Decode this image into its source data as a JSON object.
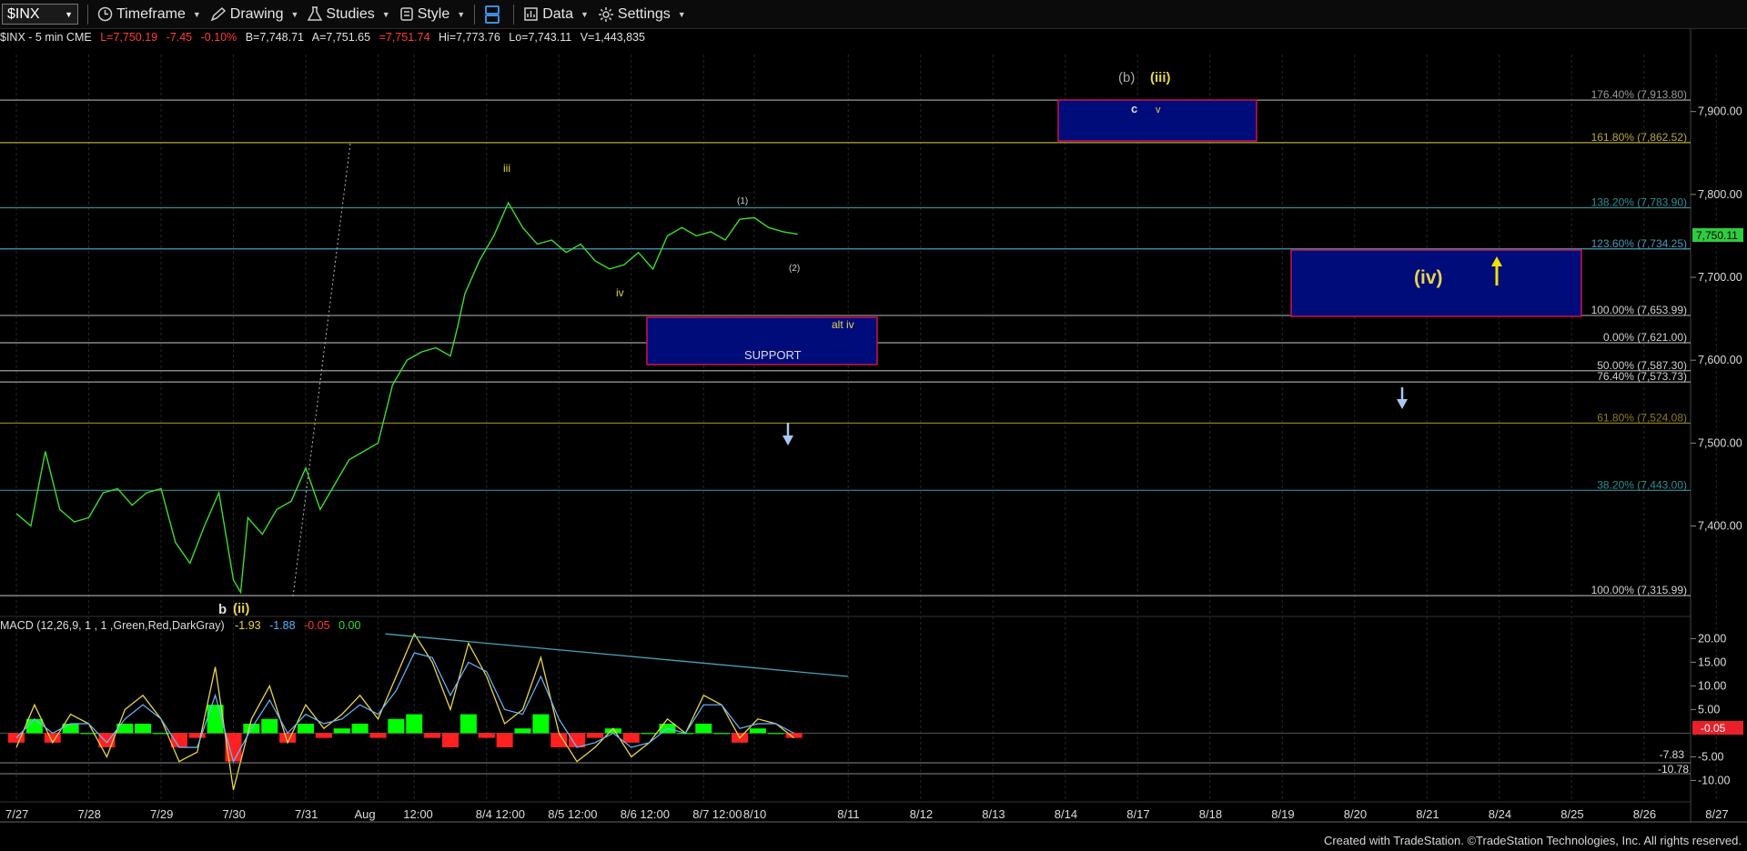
{
  "toolbar": {
    "symbol": "$INX",
    "timeframe": "Timeframe",
    "drawing": "Drawing",
    "studies": "Studies",
    "style": "Style",
    "data": "Data",
    "settings": "Settings"
  },
  "info": {
    "name": "$INX - 5 min  CME",
    "last": "L=7,750.19",
    "chg": "-7.45",
    "pct": "-0.10%",
    "bid": "B=7,748.71",
    "ask": "A=7,751.65",
    "boxed": "=7,751.74",
    "hi": "Hi=7,773.76",
    "lo": "Lo=7,743.11",
    "vol": "V=1,443,835"
  },
  "macd_info": {
    "label": "MACD (12,26,9, 1 , 1 ,Green,Red,DarkGray)",
    "v1": "-1.93",
    "v2": "-1.88",
    "v3": "-0.05",
    "v4": "0.00",
    "marker_lo1": "-7.83",
    "marker_lo2": "-10.78"
  },
  "colors": {
    "price": "#3ddc2e",
    "macd_up": "#00ff00",
    "macd_down": "#ff2020",
    "box_fill": "#000c7a",
    "box_border": "#d0104a",
    "up_text": "#ff3b3b",
    "down_text": "#ff3b3b",
    "wave_yellow": "#e8d44a"
  },
  "chart_data": {
    "type": "line",
    "price_axis": {
      "ticks": [
        "7,900.00",
        "7,800.00",
        "7,700.00",
        "7,600.00",
        "7,500.00",
        "7,400.00"
      ],
      "values": [
        7900,
        7800,
        7700,
        7600,
        7500,
        7400
      ],
      "range": [
        7315,
        7915
      ],
      "current": "7,750.11",
      "current_value": 7750.11
    },
    "macd_axis": {
      "ticks": [
        "20.00",
        "15.00",
        "10.00",
        "5.00",
        "-5.00",
        "-10.00"
      ],
      "values": [
        20,
        15,
        10,
        5,
        -5,
        -10
      ],
      "range": [
        -13,
        22
      ],
      "current": "-0.05",
      "current_value": -0.05
    },
    "dates": [
      "7/27",
      "7/28",
      "7/29",
      "7/30",
      "7/31",
      "Aug",
      "12:00",
      "8/4 12:00",
      "8/5 12:00",
      "8/6 12:00",
      "8/7 12:00",
      "8/10",
      "8/11",
      "8/12",
      "8/13",
      "8/14",
      "8/17",
      "8/18",
      "8/19",
      "8/20",
      "8/21",
      "8/24",
      "8/25",
      "8/26",
      "8/27"
    ],
    "date_index": [
      0,
      1,
      2,
      3,
      4,
      5,
      5.5,
      6.5,
      7.5,
      8.5,
      9.5,
      10.2,
      11.5,
      12.5,
      13.5,
      14.5,
      15.5,
      16.5,
      17.5,
      18.5,
      19.5,
      20.5,
      21.5,
      22.5,
      23.5
    ],
    "fib_levels": [
      {
        "label": "176.40% (7,913.80)",
        "value": 7913.8,
        "color": "#9a9a9a"
      },
      {
        "label": "161.80% (7,862.52)",
        "value": 7862.52,
        "color": "#b6a83c"
      },
      {
        "label": "138.20% (7,783.90)",
        "value": 7783.9,
        "color": "#2f8f96"
      },
      {
        "label": "123.60% (7,734.25)",
        "value": 7734.25,
        "color": "#4a9bbd"
      },
      {
        "label": "100.00% (7,653.99)",
        "value": 7653.99,
        "color": "#a0a0a0"
      },
      {
        "label": "0.00% (7,621.00)",
        "value": 7621.0,
        "color": "#a0a0a0"
      },
      {
        "label": "50.00% (7,587.30)",
        "value": 7587.3,
        "color": "#a0a0a0"
      },
      {
        "label": "76.40% (7,573.73)",
        "value": 7573.73,
        "color": "#a0a0a0"
      },
      {
        "label": "61.80% (7,524.08)",
        "value": 7524.08,
        "color": "#8a7d1e"
      },
      {
        "label": "38.20% (7,443.00)",
        "value": 7443.0,
        "color": "#2f8f96"
      },
      {
        "label": "100.00% (7,315.99)",
        "value": 7315.99,
        "color": "#a0a0a0"
      }
    ],
    "price_series": {
      "name": "$INX",
      "x": [
        0,
        0.2,
        0.4,
        0.6,
        0.8,
        1.0,
        1.2,
        1.4,
        1.6,
        1.8,
        2.0,
        2.2,
        2.4,
        2.6,
        2.8,
        3.0,
        3.1,
        3.2,
        3.4,
        3.6,
        3.8,
        4.0,
        4.2,
        4.4,
        4.6,
        4.8,
        5.0,
        5.2,
        5.4,
        5.6,
        5.8,
        6.0,
        6.1,
        6.2,
        6.4,
        6.6,
        6.8,
        7.0,
        7.2,
        7.4,
        7.6,
        7.8,
        8.0,
        8.2,
        8.4,
        8.6,
        8.8,
        9.0,
        9.2,
        9.4,
        9.6,
        9.8,
        10.0,
        10.2,
        10.4,
        10.6,
        10.8
      ],
      "y": [
        7415,
        7400,
        7490,
        7420,
        7405,
        7410,
        7440,
        7445,
        7425,
        7440,
        7445,
        7380,
        7355,
        7400,
        7440,
        7335,
        7320,
        7410,
        7390,
        7420,
        7430,
        7470,
        7420,
        7450,
        7480,
        7490,
        7500,
        7570,
        7600,
        7610,
        7615,
        7605,
        7640,
        7680,
        7720,
        7750,
        7790,
        7760,
        7740,
        7745,
        7730,
        7740,
        7720,
        7710,
        7715,
        7730,
        7710,
        7750,
        7760,
        7750,
        7755,
        7745,
        7770,
        7772,
        7760,
        7755,
        7752
      ]
    },
    "macd_series": {
      "names": [
        "MACD",
        "Signal",
        "Histogram"
      ],
      "x": [
        0,
        0.25,
        0.5,
        0.75,
        1.0,
        1.25,
        1.5,
        1.75,
        2.0,
        2.25,
        2.5,
        2.75,
        3.0,
        3.25,
        3.5,
        3.75,
        4.0,
        4.25,
        4.5,
        4.75,
        5.0,
        5.25,
        5.5,
        5.75,
        6.0,
        6.25,
        6.5,
        6.75,
        7.0,
        7.25,
        7.5,
        7.75,
        8.0,
        8.25,
        8.5,
        8.75,
        9.0,
        9.25,
        9.5,
        9.75,
        10.0,
        10.25,
        10.5,
        10.75
      ],
      "macd": [
        -3,
        6,
        -2,
        4,
        2,
        -5,
        5,
        8,
        3,
        -6,
        -4,
        14,
        -12,
        3,
        10,
        -2,
        6,
        1,
        4,
        8,
        3,
        12,
        21,
        15,
        5,
        19,
        12,
        2,
        5,
        16,
        0,
        -6,
        -3,
        1,
        -5,
        -2,
        3,
        0,
        8,
        6,
        -1,
        3,
        2,
        -1
      ],
      "signal": [
        -1,
        3,
        0,
        2,
        2,
        -2,
        3,
        6,
        3,
        -3,
        -3,
        8,
        -6,
        1,
        7,
        0,
        4,
        2,
        3,
        6,
        4,
        9,
        17,
        16,
        8,
        15,
        13,
        5,
        4,
        12,
        3,
        -3,
        -2,
        0,
        -3,
        -2,
        1,
        0,
        6,
        6,
        1,
        2,
        2,
        0
      ]
    },
    "trendlines": [
      {
        "from": [
          5.1,
          21
        ],
        "to": [
          11.5,
          12
        ],
        "color": "#4aa3b8",
        "pane": "macd"
      }
    ]
  },
  "annotations": {
    "wave_b_upper": "(b)",
    "wave_iii_upper": "(iii)",
    "wave_c": "c",
    "wave_v": "v",
    "wave_iii_small": "iii",
    "wave_1": "(1)",
    "wave_2": "(2)",
    "wave_iv_small": "iv",
    "wave_alt_iv": "alt iv",
    "support": "SUPPORT",
    "wave_iv_big": "(iv)",
    "wave_b_low": "b",
    "wave_ii": "(ii)"
  },
  "credit": "Created with TradeStation. ©TradeStation Technologies, Inc. All rights reserved."
}
